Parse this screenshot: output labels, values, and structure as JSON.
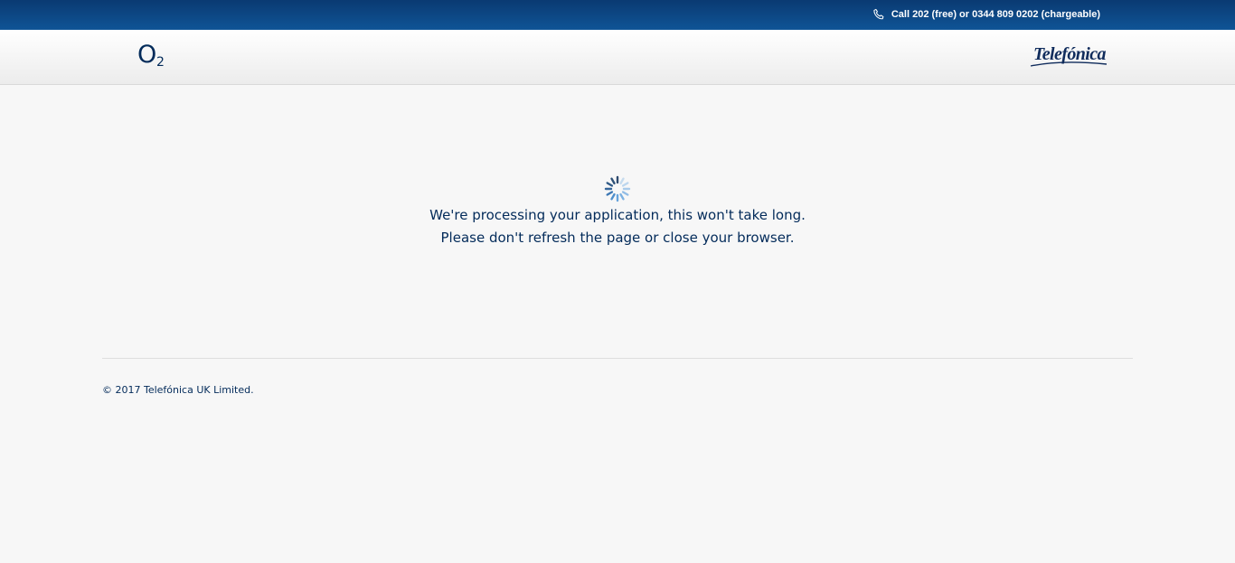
{
  "topbar": {
    "call_text": "Call 202 (free) or 0344 809 0202 (chargeable)",
    "phone_icon": "phone-icon"
  },
  "header": {
    "logo_left": {
      "main": "O",
      "sub": "2"
    },
    "logo_right": "Telefónica"
  },
  "main": {
    "spinner_icon": "loading-spinner-icon",
    "message_line1": "We're processing your application, this won't take long.",
    "message_line2": "Please don't refresh the page or close your browser."
  },
  "footer": {
    "copyright": "© 2017 Telefónica UK Limited."
  },
  "colors": {
    "topbar_start": "#0a3a72",
    "topbar_end": "#0f5496",
    "brand_navy": "#032b5a",
    "background": "#f7f7f7"
  }
}
